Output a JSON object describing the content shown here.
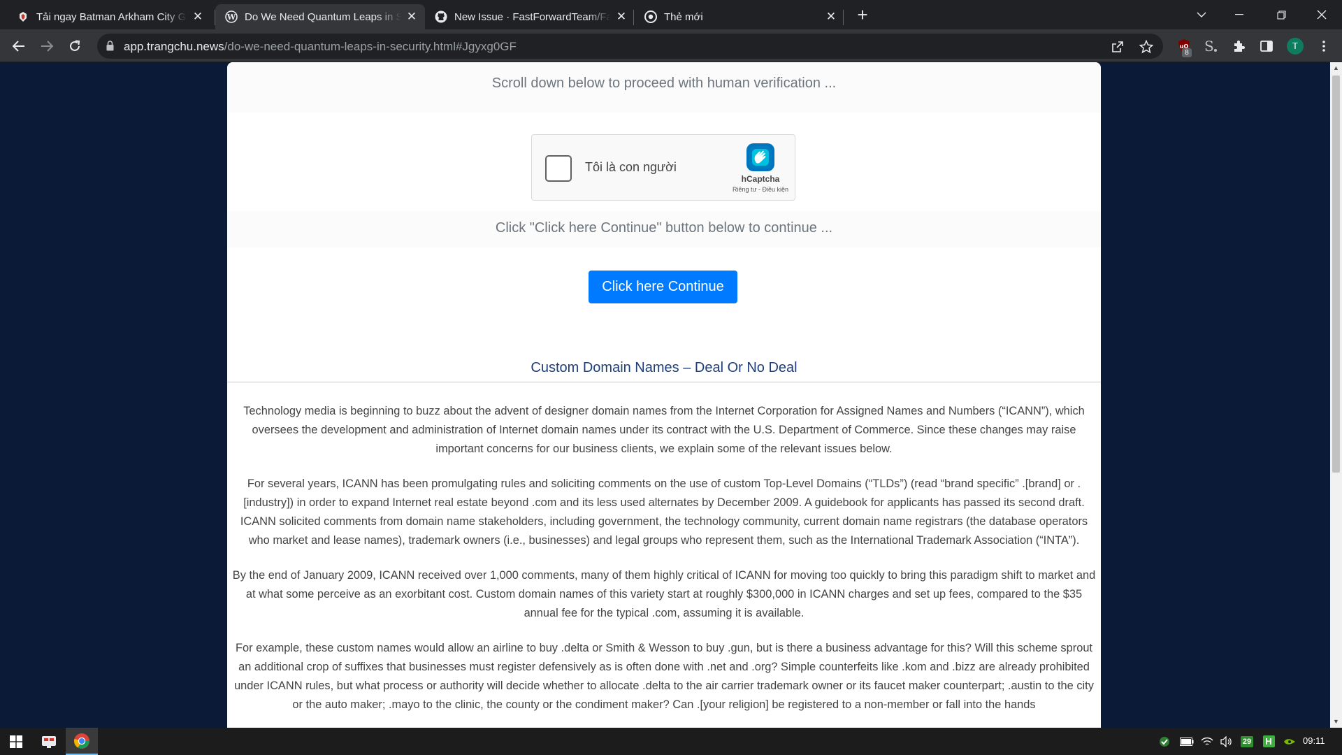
{
  "browser": {
    "tabs": [
      {
        "title": "Tải ngay Batman Arkham City Game",
        "favicon": "batman-favicon-icon",
        "active": false
      },
      {
        "title": "Do We Need Quantum Leaps in Security",
        "favicon": "wordpress-icon",
        "active": true
      },
      {
        "title": "New Issue · FastForwardTeam/FastForward",
        "favicon": "github-icon",
        "active": false
      },
      {
        "title": "Thẻ mới",
        "favicon": "chrome-icon",
        "active": false
      }
    ],
    "url_host": "app.trangchu.news",
    "url_path": "/do-we-need-quantum-leaps-in-security.html#Jgyxg0GF",
    "extension_badge": "8",
    "profile_initial": "T"
  },
  "page": {
    "scroll_notice": "Scroll down below to proceed with human verification ...",
    "captcha": {
      "checkbox_label": "Tôi là con người",
      "brand": "hCaptcha",
      "links": "Riêng tư - Điều kiện"
    },
    "continue_notice": "Click \"Click here Continue\" button below to continue ...",
    "continue_button": "Click here Continue",
    "article": {
      "heading": "Custom Domain Names – Deal Or No Deal",
      "paragraphs": [
        "Technology media is beginning to buzz about the advent of designer domain names from the Internet Corporation for Assigned Names and Numbers (“ICANN”), which oversees the development and administration of Internet domain names under its contract with the U.S. Department of Commerce. Since these changes may raise important concerns for our business clients, we explain some of the relevant issues below.",
        "For several years, ICANN has been promulgating rules and soliciting comments on the use of custom Top-Level Domains (“TLDs”) (read “brand specific” .[brand] or .[industry]) in order to expand Internet real estate beyond .com and its less used alternates by December 2009. A guidebook for applicants has passed its second draft. ICANN solicited comments from domain name stakeholders, including government, the technology community, current domain name registrars (the database operators who market and lease names), trademark owners (i.e., businesses) and legal groups who represent them, such as the International Trademark Association (“INTA”).",
        "By the end of January 2009, ICANN received over 1,000 comments, many of them highly critical of ICANN for moving too quickly to bring this paradigm shift to market and at what some perceive as an exorbitant cost. Custom domain names of this variety start at roughly $300,000 in ICANN charges and set up fees, compared to the $35 annual fee for the typical .com, assuming it is available.",
        "For example, these custom names would allow an airline to buy .delta or Smith & Wesson to buy .gun, but is there a business advantage for this? Will this scheme sprout an additional crop of suffixes that businesses must register defensively as is often done with .net and .org? Simple counterfeits like .kom and .bizz are already prohibited under ICANN rules, but what process or authority will decide whether to allocate .delta to the air carrier trademark owner or its faucet maker counterpart; .austin to the city or the auto maker; .mayo to the clinic, the county or the condiment maker? Can .[your religion] be registered to a non-member or fall into the hands"
      ]
    }
  },
  "taskbar": {
    "tray_badge": "29",
    "clock": "09:11"
  },
  "colors": {
    "page_background": "#0b1a36",
    "button_primary": "#007bff",
    "heading": "#1f3e7a"
  }
}
